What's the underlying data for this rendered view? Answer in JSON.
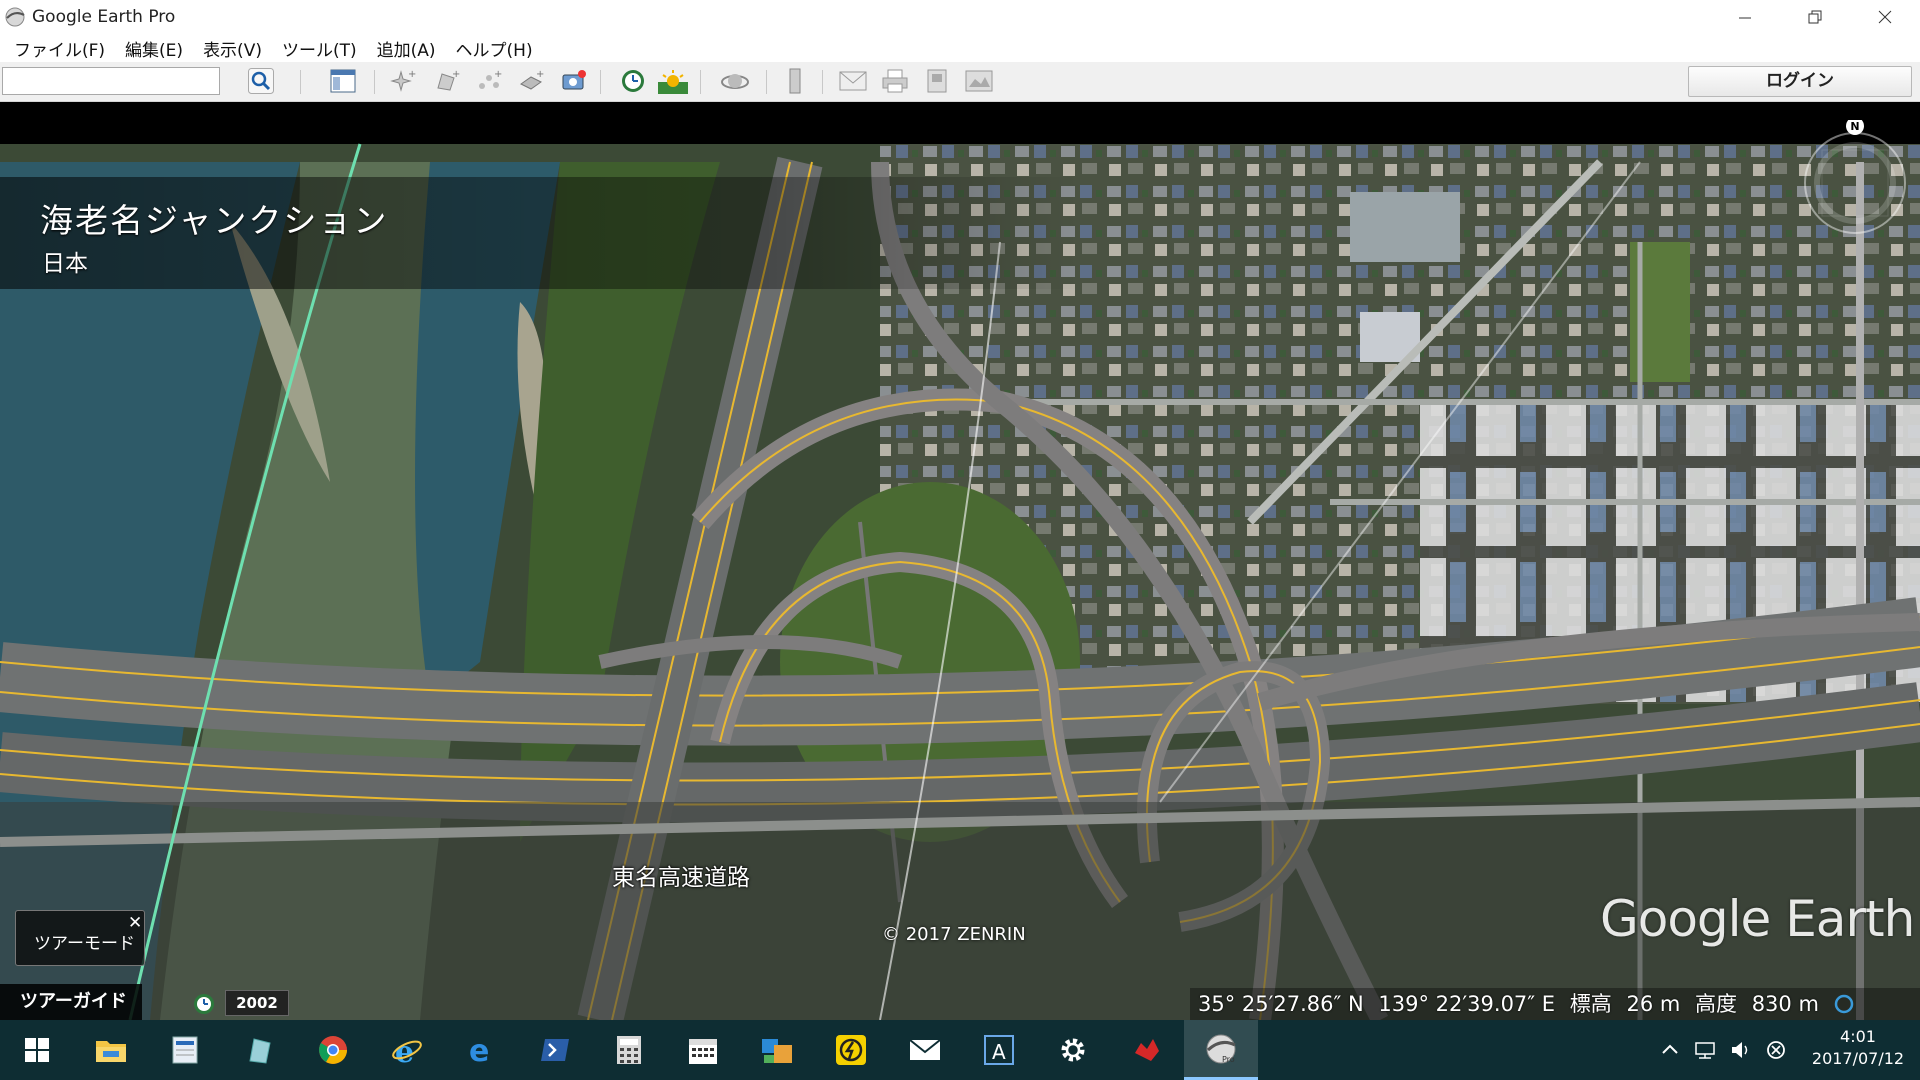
{
  "window": {
    "title": "Google Earth Pro"
  },
  "menu": [
    {
      "label": "ファイル(F)"
    },
    {
      "label": "編集(E)"
    },
    {
      "label": "表示(V)"
    },
    {
      "label": "ツール(T)"
    },
    {
      "label": "追加(A)"
    },
    {
      "label": "ヘルプ(H)"
    }
  ],
  "toolbar": {
    "search_value": "",
    "login_label": "ログイン"
  },
  "map": {
    "place_name": "海老名ジャンクション",
    "place_country": "日本",
    "road_label": "東名高速道路",
    "copyright": "© 2017 ZENRIN",
    "brand": "Google Earth",
    "compass_north": "N"
  },
  "tour": {
    "mode_label": "ツアーモード",
    "close_glyph": "✕",
    "guide_label": "ツアーガイド",
    "year": "2002"
  },
  "status": {
    "lat": "35° 25′27.86″ N",
    "lon": "139° 22′39.07″ E",
    "elev_label": "標高",
    "elev_value": "26 m",
    "alt_label": "高度",
    "alt_value": "830 m"
  },
  "taskbar": {
    "icons": [
      "windows-start-icon",
      "file-explorer-icon",
      "document-app-icon",
      "notes-app-icon",
      "chrome-icon",
      "internet-explorer-icon",
      "edge-icon",
      "powershell-icon",
      "calculator-icon",
      "calendar-icon",
      "photos-icon",
      "power-app-icon",
      "mail-icon",
      "font-app-icon",
      "settings-icon",
      "red-app-icon",
      "google-earth-pro-icon"
    ]
  },
  "clock": {
    "time": "4:01",
    "date": "2017/07/12"
  },
  "colors": {
    "taskbar": "#0e2d33",
    "road_yellow": "#e8b830",
    "river": "#2e5a68"
  }
}
